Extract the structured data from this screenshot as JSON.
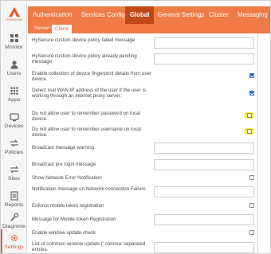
{
  "brand": {
    "name": "HySecure",
    "color": "#e45a28"
  },
  "sidebar": {
    "items": [
      {
        "label": "Monitor",
        "icon": "monitor-icon"
      },
      {
        "label": "Users",
        "icon": "users-icon"
      },
      {
        "label": "Apps",
        "icon": "apps-icon"
      },
      {
        "label": "Devices",
        "icon": "devices-icon"
      },
      {
        "label": "Policies",
        "icon": "policies-icon"
      },
      {
        "label": "Sites",
        "icon": "sites-icon"
      },
      {
        "label": "Reports",
        "icon": "reports-icon"
      },
      {
        "label": "Diagnose",
        "icon": "diagnose-icon"
      },
      {
        "label": "Settings",
        "icon": "gear-icon",
        "active": true
      }
    ]
  },
  "topbar": {
    "accent": "#f07b46",
    "active_color": "#c24818",
    "tabs": [
      {
        "label": "Authentication"
      },
      {
        "label": "Services Config"
      },
      {
        "label": "Global",
        "active": true
      },
      {
        "label": "General Settings"
      },
      {
        "label": "Cluster"
      },
      {
        "label": "Messaging"
      }
    ]
  },
  "subtabs": [
    {
      "label": "Server"
    },
    {
      "label": "Client",
      "active": true
    }
  ],
  "settings": [
    {
      "label": "HySecure custom device policy failed message",
      "control": "text",
      "value": ""
    },
    {
      "label": "HySecure custom device policy already pending message",
      "control": "text",
      "value": ""
    },
    {
      "label": "Enable collection of device fingerprint details from user device.",
      "control": "checkbox",
      "checked": true
    },
    {
      "label": "Detect real WAN IP address of the user if the user is working through an internet proxy server.",
      "control": "checkbox",
      "checked": true
    },
    {
      "label": "Do not allow user to remember password on local device.",
      "control": "checkbox",
      "checked": false,
      "highlighted": true
    },
    {
      "label": "Do not allow user to remember username on local device.",
      "control": "checkbox",
      "checked": false,
      "highlighted": true
    },
    {
      "label": "Broadcast message warning.",
      "control": "text",
      "value": ""
    },
    {
      "label": "Broadcast pre login message",
      "control": "text",
      "value": ""
    },
    {
      "label": "Show Network Error Notification",
      "control": "checkbox",
      "checked": false
    },
    {
      "label": "Notification message on Network connection Failure.",
      "control": "text",
      "value": ""
    },
    {
      "label": "Enforce mobile token registration",
      "control": "checkbox",
      "checked": false
    },
    {
      "label": "Message for Mobile token Registration",
      "control": "text",
      "value": ""
    },
    {
      "label": "Enable window update check",
      "control": "checkbox",
      "checked": false
    },
    {
      "label": "List of common window update (',comma' separated entries.",
      "control": "text",
      "value": ""
    }
  ]
}
